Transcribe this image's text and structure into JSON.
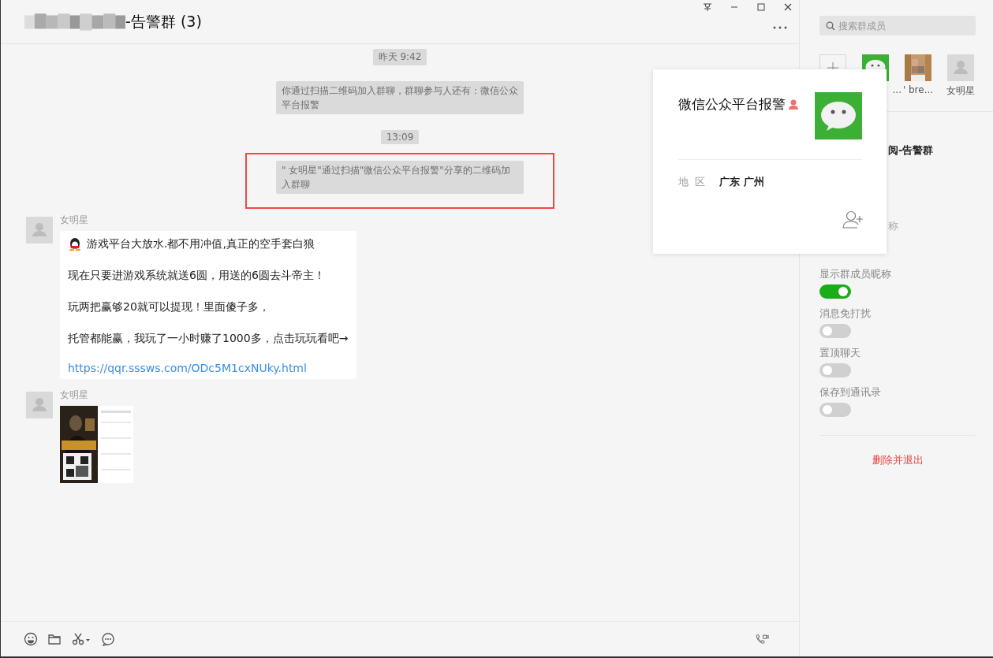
{
  "chat": {
    "title": "-告警群 (3)",
    "messages": [
      {
        "kind": "time",
        "text": "昨天 9:42"
      },
      {
        "kind": "system",
        "text": "你通过扫描二维码加入群聊，群聊参与人还有：微信公众平台报警",
        "highlighted": false
      },
      {
        "kind": "time",
        "text": "13:09"
      },
      {
        "kind": "system",
        "text": "\" 女明星\"通过扫描\"微信公众平台报警\"分享的二维码加入群聊",
        "highlighted": true
      },
      {
        "kind": "text",
        "sender": "女明星",
        "headline": "游戏平台大放水.都不用冲值,真正的空手套白狼",
        "lines": [
          "现在只要进游戏系统就送6圆，用送的6圆去斗帝主！",
          "玩两把赢够20就可以提现！里面傻子多，",
          "托管都能赢，我玩了一小时赚了1000多，点击玩玩看吧→"
        ],
        "link": "https://qqr.sssws.com/ODc5M1cxNUky.html"
      },
      {
        "sender": "女明星"
      }
    ]
  },
  "sidebar": {
    "search": {
      "placeholder": "搜索群成员"
    },
    "members": [
      {
        "kind": "add"
      },
      {
        "kind": "wechat",
        "name": "..."
      },
      {
        "name": "'  bre..."
      },
      {
        "kind": "default",
        "name": "女明星"
      }
    ],
    "group_name_fragment": "阅-告警群",
    "nickname_fragment": "称",
    "toggles": [
      {
        "label": "显示群成员昵称",
        "on": true
      },
      {
        "label": "消息免打扰",
        "on": false
      },
      {
        "label": "置顶聊天",
        "on": false
      },
      {
        "label": "保存到通讯录",
        "on": false
      }
    ],
    "exit_button": "删除并退出"
  },
  "popup": {
    "name": "微信公众平台报警",
    "region_label": "地  区",
    "region": "广东 广州"
  }
}
